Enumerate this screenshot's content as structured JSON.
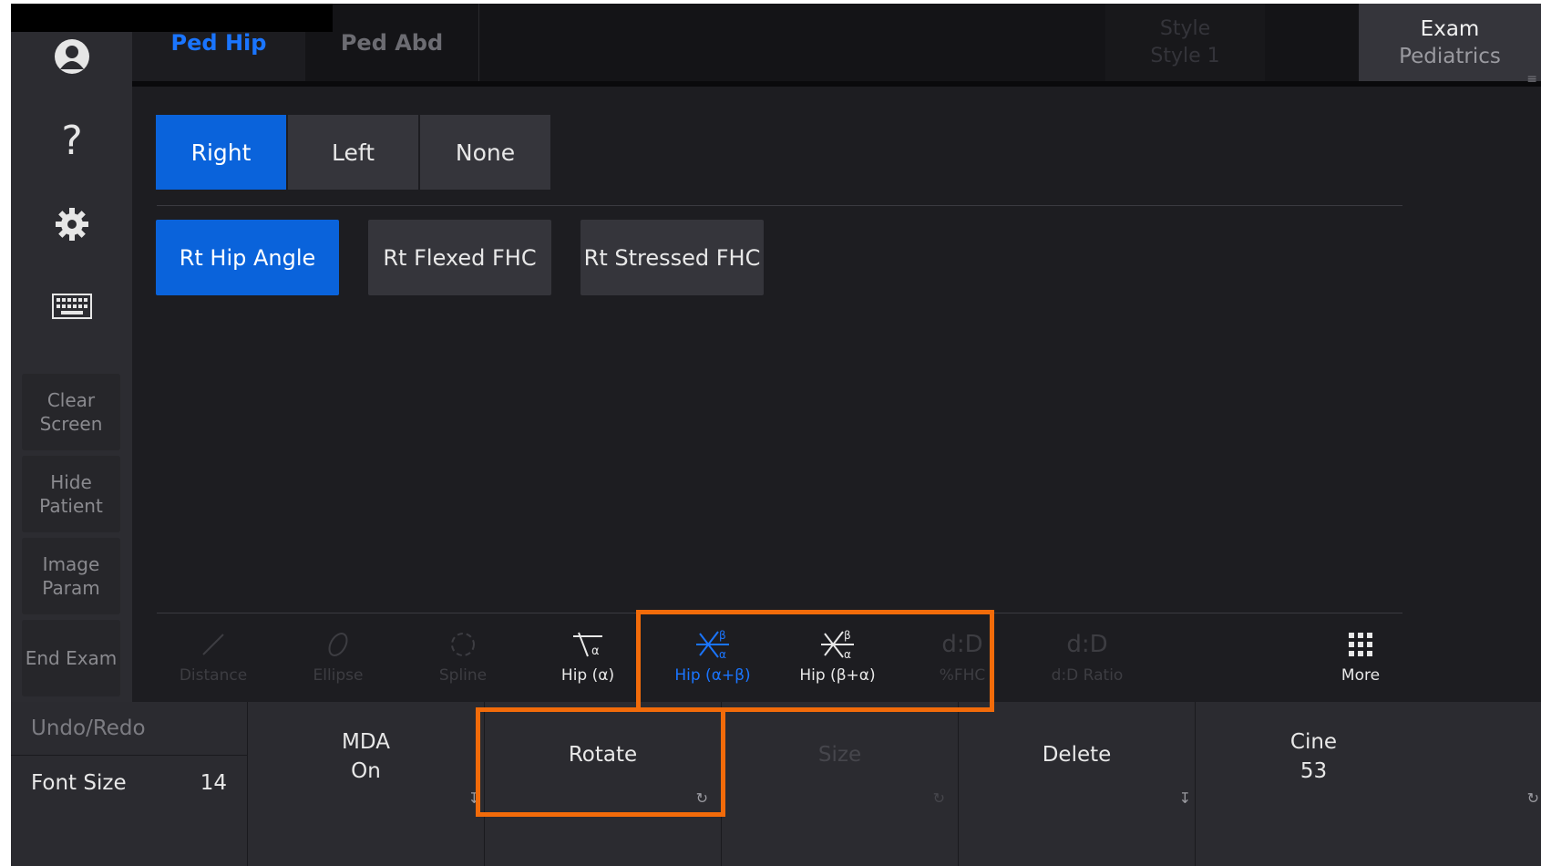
{
  "sidebar": {
    "icons": [
      "user-icon",
      "help-icon",
      "gear-icon",
      "keyboard-icon"
    ],
    "help_glyph": "?",
    "buttons": {
      "clear_screen": "Clear\nScreen",
      "hide_patient": "Hide\nPatient",
      "image_param": "Image\nParam",
      "end_exam": "End Exam"
    }
  },
  "tabs": {
    "active": "Ped Hip",
    "inactive": "Ped Abd"
  },
  "style_button": {
    "title": "Style",
    "value": "Style 1"
  },
  "exam_button": {
    "title": "Exam",
    "value": "Pediatrics"
  },
  "side_selector": {
    "options": [
      "Right",
      "Left",
      "None"
    ],
    "selected": "Right"
  },
  "measurements": [
    "Rt  Hip Angle",
    "Rt  Flexed FHC",
    "Rt  Stressed FHC"
  ],
  "tools": {
    "distance": "Distance",
    "ellipse": "Ellipse",
    "spline": "Spline",
    "hip_a": "Hip (α)",
    "hip_ab": "Hip (α+β)",
    "hip_ba": "Hip (β+α)",
    "pct_fhc_icon": "d:D",
    "pct_fhc": "%FHC",
    "dd_ratio_icon": "d:D",
    "dd_ratio": "d:D Ratio",
    "more": "More"
  },
  "bottom": {
    "undo_redo": "Undo/Redo",
    "font_size_label": "Font Size",
    "font_size_value": "14",
    "mda_title": "MDA",
    "mda_value": "On",
    "rotate": "Rotate",
    "size": "Size",
    "delete": "Delete",
    "cine_title": "Cine",
    "cine_value": "53"
  },
  "colors": {
    "accent_blue": "#0a63db",
    "highlight_orange": "#f26b0a",
    "background": "#1d1d21"
  }
}
